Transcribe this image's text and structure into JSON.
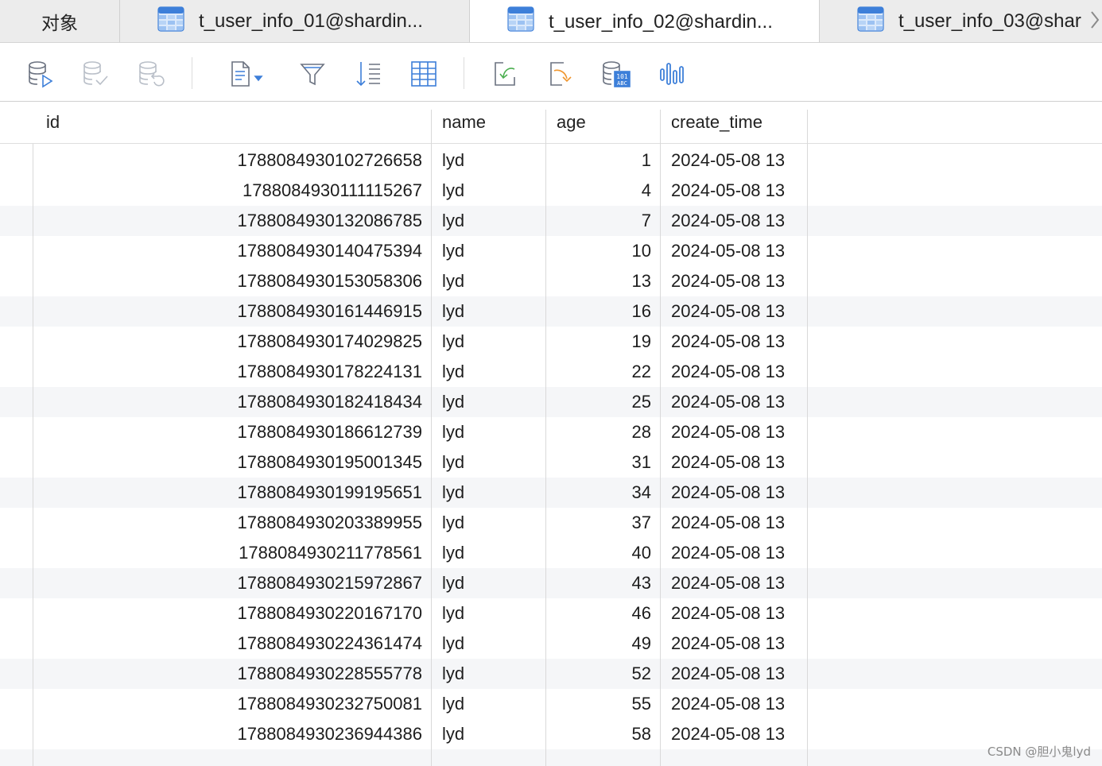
{
  "tabs": [
    {
      "label": "对象",
      "active": false
    },
    {
      "label": "t_user_info_01@shardin...",
      "active": false
    },
    {
      "label": "t_user_info_02@shardin...",
      "active": true
    },
    {
      "label": "t_user_info_03@shar",
      "active": false
    }
  ],
  "tab_overflow_icon": "chevron-right-icon",
  "toolbar_icons": [
    "database-run-icon",
    "database-commit-icon",
    "database-rollback-icon",
    "text-view-icon",
    "filter-icon",
    "sort-icon",
    "grid-view-icon",
    "import-icon",
    "export-icon",
    "data-generator-icon",
    "chart-icon"
  ],
  "grid": {
    "columns": [
      "id",
      "name",
      "age",
      "create_time"
    ],
    "rows": [
      [
        "1788084930102726658",
        "lyd",
        "1",
        "2024-05-08 13"
      ],
      [
        "1788084930111115267",
        "lyd",
        "4",
        "2024-05-08 13"
      ],
      [
        "1788084930132086785",
        "lyd",
        "7",
        "2024-05-08 13"
      ],
      [
        "1788084930140475394",
        "lyd",
        "10",
        "2024-05-08 13"
      ],
      [
        "1788084930153058306",
        "lyd",
        "13",
        "2024-05-08 13"
      ],
      [
        "1788084930161446915",
        "lyd",
        "16",
        "2024-05-08 13"
      ],
      [
        "1788084930174029825",
        "lyd",
        "19",
        "2024-05-08 13"
      ],
      [
        "1788084930178224131",
        "lyd",
        "22",
        "2024-05-08 13"
      ],
      [
        "1788084930182418434",
        "lyd",
        "25",
        "2024-05-08 13"
      ],
      [
        "1788084930186612739",
        "lyd",
        "28",
        "2024-05-08 13"
      ],
      [
        "1788084930195001345",
        "lyd",
        "31",
        "2024-05-08 13"
      ],
      [
        "1788084930199195651",
        "lyd",
        "34",
        "2024-05-08 13"
      ],
      [
        "1788084930203389955",
        "lyd",
        "37",
        "2024-05-08 13"
      ],
      [
        "1788084930211778561",
        "lyd",
        "40",
        "2024-05-08 13"
      ],
      [
        "1788084930215972867",
        "lyd",
        "43",
        "2024-05-08 13"
      ],
      [
        "1788084930220167170",
        "lyd",
        "46",
        "2024-05-08 13"
      ],
      [
        "1788084930224361474",
        "lyd",
        "49",
        "2024-05-08 13"
      ],
      [
        "1788084930228555778",
        "lyd",
        "52",
        "2024-05-08 13"
      ],
      [
        "1788084930232750081",
        "lyd",
        "55",
        "2024-05-08 13"
      ],
      [
        "1788084930236944386",
        "lyd",
        "58",
        "2024-05-08 13"
      ]
    ]
  },
  "watermark": "CSDN @胆小鬼lyd",
  "colors": {
    "accent": "#3d7fd9",
    "tab_bar_bg": "#ececec",
    "row_alt_bg": "#f5f6f8",
    "icon_gray": "#9aa1ab",
    "import_green": "#4caf50",
    "export_orange": "#f0962e"
  }
}
